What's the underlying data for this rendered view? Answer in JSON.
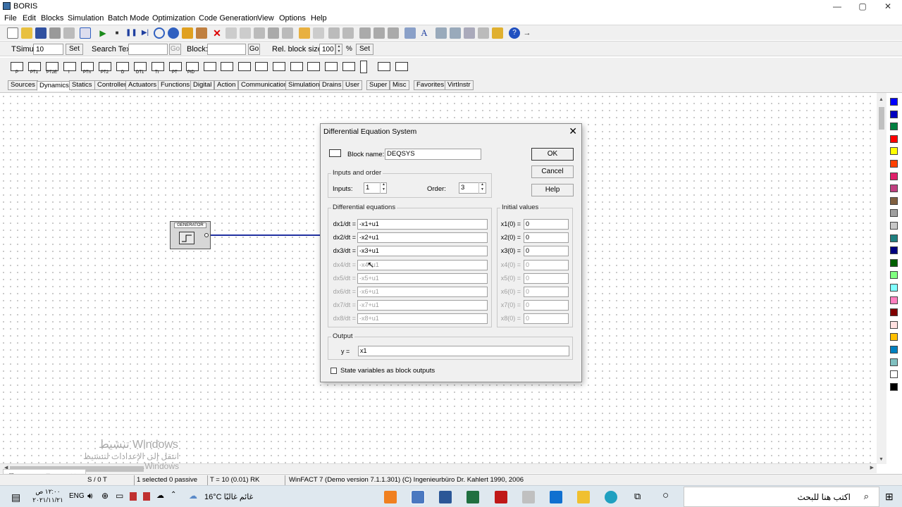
{
  "app": {
    "title": "BORIS"
  },
  "window_controls": {
    "minimize": "—",
    "maximize": "▢",
    "close": "✕"
  },
  "menu": [
    "File",
    "Edit",
    "Blocks",
    "Simulation",
    "Batch Mode",
    "Optimization",
    "Code Generation",
    "View",
    "Options",
    "Help"
  ],
  "toolbar2": {
    "tsimu_label": "TSimu:",
    "tsimu_value": "10",
    "set_label": "Set",
    "search_label": "Search Text:",
    "search_value": "",
    "go_label": "Go",
    "block_label": "Block:",
    "block_value": "",
    "go2_label": "Go",
    "relsize_label": "Rel. block size:",
    "relsize_value": "100",
    "percent": "%",
    "set2_label": "Set"
  },
  "palette_labels": [
    "P",
    "PT1",
    "PT2E",
    "I",
    "PTn",
    "PT2",
    "D",
    "DT1",
    "Tt",
    "PT",
    "PID"
  ],
  "tabs": [
    "Sources",
    "Dynamics",
    "Statics",
    "Controller",
    "Actuators",
    "Functions",
    "Digital",
    "Action",
    "Communication",
    "Simulation",
    "Drains",
    "User",
    "Super",
    "Misc",
    "Favorites",
    "VirtInstr"
  ],
  "active_tab": "Dynamics",
  "canvas": {
    "generator_label": "GENERATOR"
  },
  "colors": [
    "#0000ff",
    "#0000c0",
    "#008040",
    "#ff0000",
    "#ffff00",
    "#ff4000",
    "#e0206a",
    "#c04080",
    "#806040",
    "#a0a0a0",
    "#c8c8c8",
    "#208080",
    "#000080",
    "#006000",
    "#80ff80",
    "#80ffff",
    "#ff80c0",
    "#800000",
    "#ffe0e0",
    "#ffc000",
    "#0080c0",
    "#80c0c0",
    "#ffffff",
    "#000000"
  ],
  "dialog": {
    "title": "Differential Equation System",
    "close": "✕",
    "block_name_label": "Block name:",
    "block_name": "DEQSYS",
    "ok": "OK",
    "cancel": "Cancel",
    "help": "Help",
    "inputs_order_group": "Inputs and order",
    "inputs_label": "Inputs:",
    "inputs_value": "1",
    "order_label": "Order:",
    "order_value": "3",
    "diff_group": "Differential equations",
    "init_group": "Initial values",
    "equations": [
      {
        "label": "dx1/dt =",
        "value": "-x1+u1",
        "init_label": "x1(0) =",
        "init": "0",
        "enabled": true
      },
      {
        "label": "dx2/dt =",
        "value": "-x2+u1",
        "init_label": "x2(0) =",
        "init": "0",
        "enabled": true
      },
      {
        "label": "dx3/dt =",
        "value": "-x3+u1",
        "init_label": "x3(0) =",
        "init": "0",
        "enabled": true
      },
      {
        "label": "dx4/dt =",
        "value": "-x4+u1",
        "init_label": "x4(0) =",
        "init": "0",
        "enabled": false
      },
      {
        "label": "dx5/dt =",
        "value": "-x5+u1",
        "init_label": "x5(0) =",
        "init": "0",
        "enabled": false
      },
      {
        "label": "dx6/dt =",
        "value": "-x6+u1",
        "init_label": "x6(0) =",
        "init": "0",
        "enabled": false
      },
      {
        "label": "dx7/dt =",
        "value": "-x7+u1",
        "init_label": "x7(0) =",
        "init": "0",
        "enabled": false
      },
      {
        "label": "dx8/dt =",
        "value": "-x8+u1",
        "init_label": "x8(0) =",
        "init": "0",
        "enabled": false
      }
    ],
    "output_group": "Output",
    "output_label": "y =",
    "output_value": "x1",
    "state_checkbox_label": "State variables as block outputs"
  },
  "watermark": {
    "line1": "تنشيط Windows",
    "line2": "انتقل إلى الإعدادات لتنشيط Windows."
  },
  "status": {
    "mode": "S / 0 T",
    "selected": "1 selected  0 passive",
    "time": "T = 10  (0.01)  RK",
    "version": "WinFACT 7 (Demo version 7.1.1.301)  (C) Ingenieurbüro Dr. Kahlert 1990, 2006"
  },
  "taskbar": {
    "time": "١٢:٠٠ ص",
    "date": "٢٠٢١/١١/٢١",
    "lang": "ENG",
    "weather": "16°C  غائم غالبًا",
    "search_placeholder": "اكتب هنا للبحث"
  }
}
